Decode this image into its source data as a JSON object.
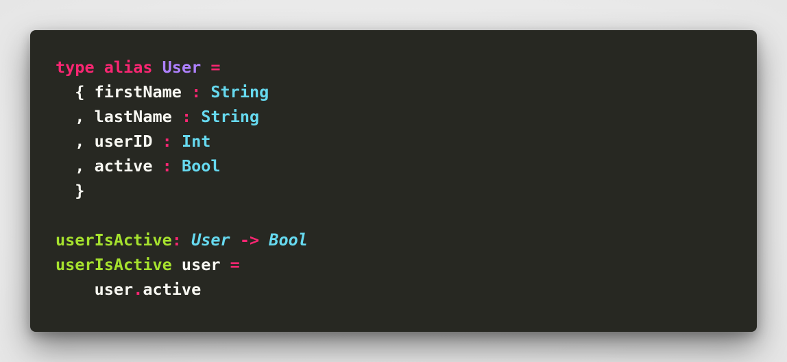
{
  "code": {
    "lines": [
      [
        {
          "text": "type",
          "role": "keyword"
        },
        {
          "text": " ",
          "role": "plain"
        },
        {
          "text": "alias",
          "role": "keyword"
        },
        {
          "text": " ",
          "role": "plain"
        },
        {
          "text": "User",
          "role": "type-name"
        },
        {
          "text": " ",
          "role": "plain"
        },
        {
          "text": "=",
          "role": "operator"
        }
      ],
      [
        {
          "text": "  { firstName ",
          "role": "plain"
        },
        {
          "text": ":",
          "role": "operator"
        },
        {
          "text": " ",
          "role": "plain"
        },
        {
          "text": "String",
          "role": "type"
        }
      ],
      [
        {
          "text": "  , lastName ",
          "role": "plain"
        },
        {
          "text": ":",
          "role": "operator"
        },
        {
          "text": " ",
          "role": "plain"
        },
        {
          "text": "String",
          "role": "type"
        }
      ],
      [
        {
          "text": "  , userID ",
          "role": "plain"
        },
        {
          "text": ":",
          "role": "operator"
        },
        {
          "text": " ",
          "role": "plain"
        },
        {
          "text": "Int",
          "role": "type"
        }
      ],
      [
        {
          "text": "  , active ",
          "role": "plain"
        },
        {
          "text": ":",
          "role": "operator"
        },
        {
          "text": " ",
          "role": "plain"
        },
        {
          "text": "Bool",
          "role": "type"
        }
      ],
      [
        {
          "text": "  }",
          "role": "plain"
        }
      ],
      [],
      [
        {
          "text": "userIsActive",
          "role": "function"
        },
        {
          "text": ":",
          "role": "operator"
        },
        {
          "text": " ",
          "role": "plain"
        },
        {
          "text": "User",
          "role": "type-italic"
        },
        {
          "text": " ",
          "role": "plain"
        },
        {
          "text": "->",
          "role": "operator"
        },
        {
          "text": " ",
          "role": "plain"
        },
        {
          "text": "Bool",
          "role": "type-italic"
        }
      ],
      [
        {
          "text": "userIsActive",
          "role": "function"
        },
        {
          "text": " user ",
          "role": "plain"
        },
        {
          "text": "=",
          "role": "operator"
        }
      ],
      [
        {
          "text": "    user",
          "role": "plain"
        },
        {
          "text": ".",
          "role": "operator"
        },
        {
          "text": "active",
          "role": "plain"
        }
      ]
    ]
  },
  "colors": {
    "background": "#272822",
    "plain": "#f8f8f2",
    "keyword": "#f92672",
    "operator": "#f92672",
    "type-name": "#ae81ff",
    "type": "#66d9ef",
    "function": "#a6e22e"
  }
}
